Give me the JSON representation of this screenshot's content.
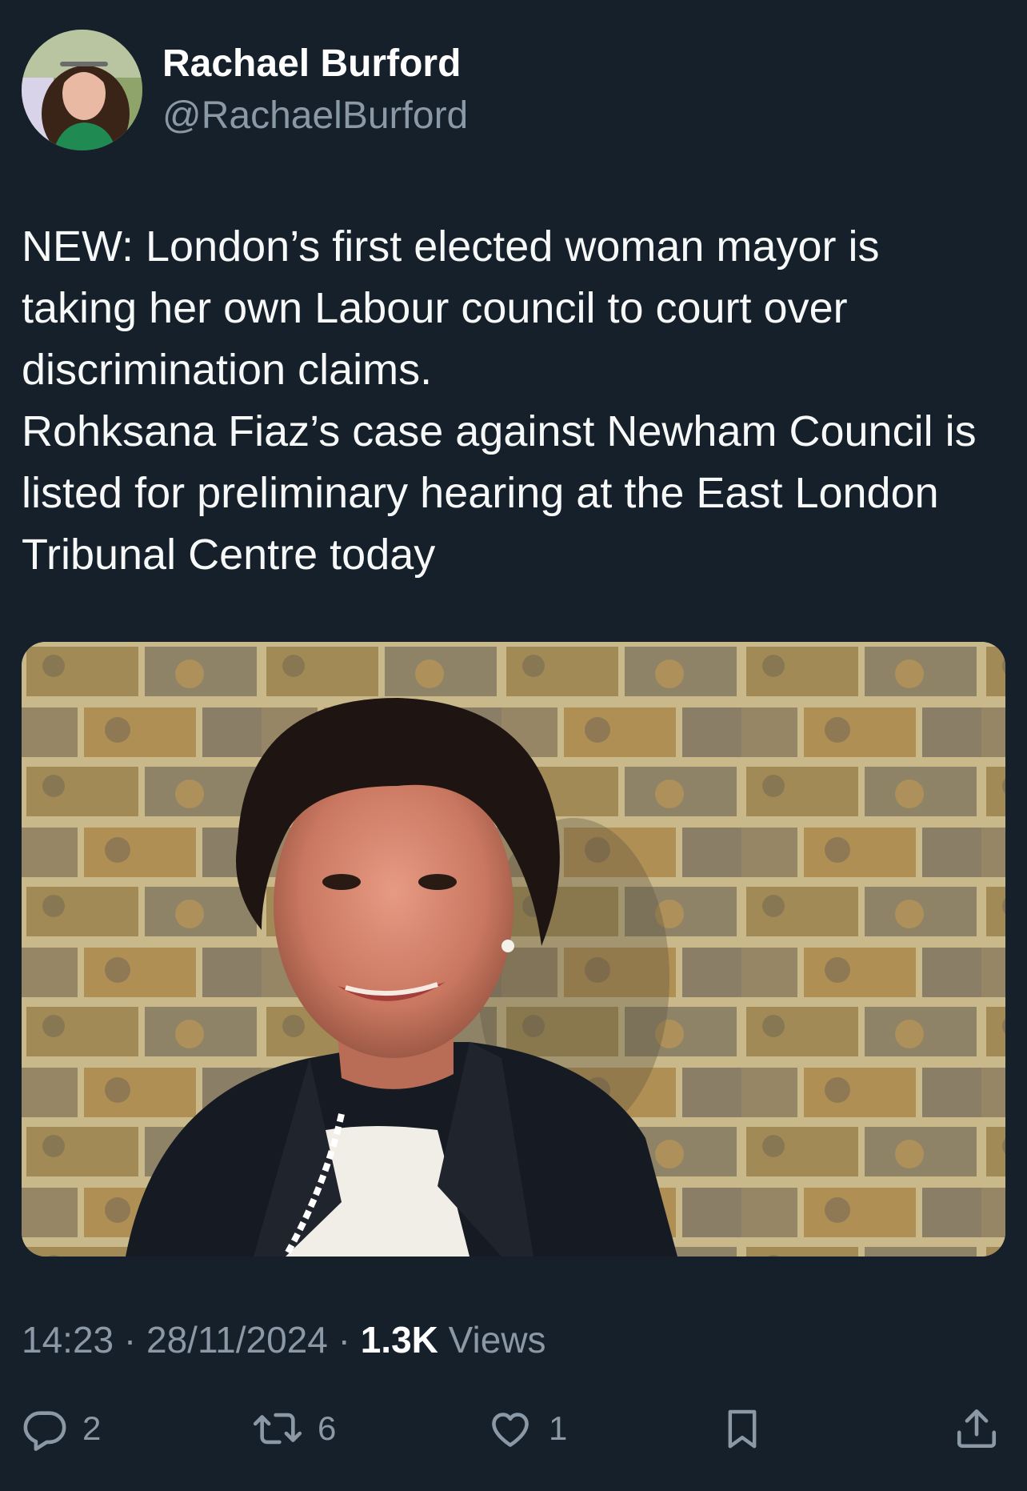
{
  "author": {
    "display_name": "Rachael Burford",
    "handle": "@RachaelBurford"
  },
  "tweet": {
    "paragraphs": [
      "NEW: London’s first elected woman mayor is taking her own Labour council to court over discrimination claims.",
      "Rohksana Fiaz’s case against Newham Council is listed for preliminary hearing at the East London Tribunal Centre today"
    ]
  },
  "meta": {
    "time": "14:23",
    "separator1": " · ",
    "date": "28/11/2024",
    "separator2": " · ",
    "views_count": "1.3K",
    "views_label": " Views"
  },
  "actions": {
    "reply_count": "2",
    "retweet_count": "6",
    "like_count": "1"
  },
  "icons": {
    "reply": "reply-icon",
    "retweet": "retweet-icon",
    "like": "heart-icon",
    "bookmark": "bookmark-icon",
    "share": "share-icon"
  },
  "colors": {
    "background": "#15202b",
    "secondary_text": "#8b98a5",
    "primary_text": "#f7f9f9"
  }
}
